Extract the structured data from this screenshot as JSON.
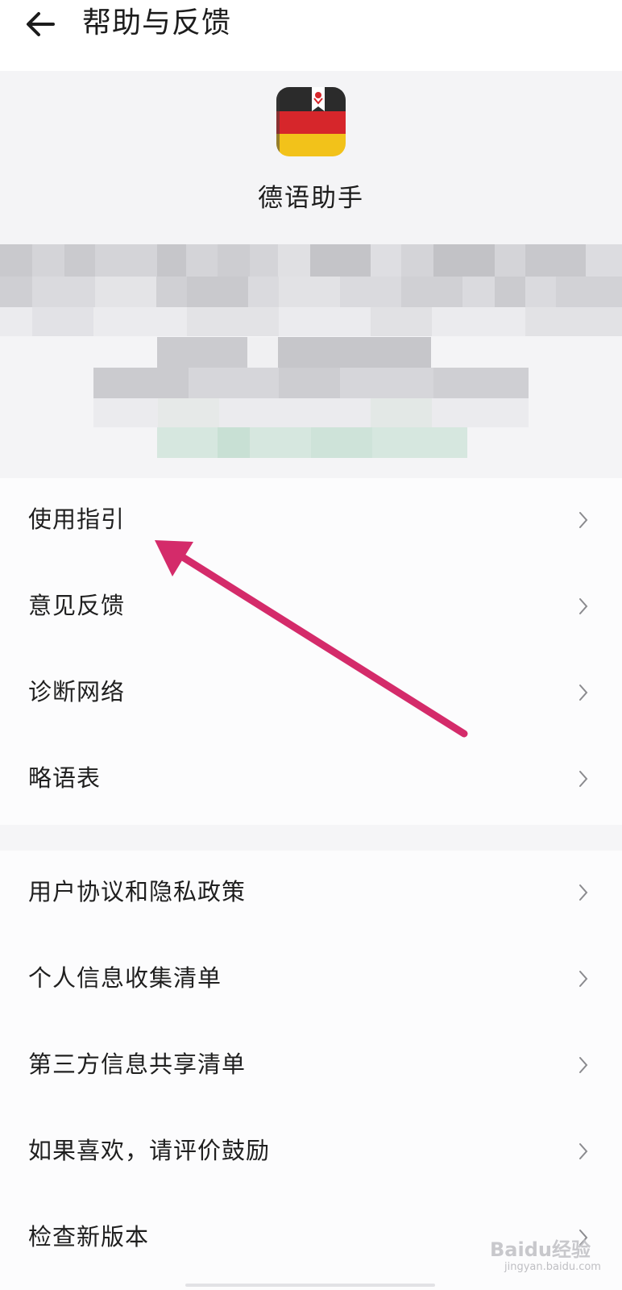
{
  "header": {
    "title": "帮助与反馈",
    "back_icon": "arrow-left-icon"
  },
  "app": {
    "name": "德语助手",
    "icon": "german-flag-book-icon"
  },
  "section1": {
    "items": [
      {
        "label": "使用指引"
      },
      {
        "label": "意见反馈"
      },
      {
        "label": "诊断网络"
      },
      {
        "label": "略语表"
      }
    ]
  },
  "section2": {
    "items": [
      {
        "label": "用户协议和隐私政策"
      },
      {
        "label": "个人信息收集清单"
      },
      {
        "label": "第三方信息共享清单"
      },
      {
        "label": "如果喜欢，请评价鼓励"
      },
      {
        "label": "检查新版本"
      }
    ]
  },
  "annotation": {
    "color": "#d42b6a"
  },
  "watermark": {
    "text": "Baidu经验",
    "sub": "jingyan.baidu.com"
  }
}
